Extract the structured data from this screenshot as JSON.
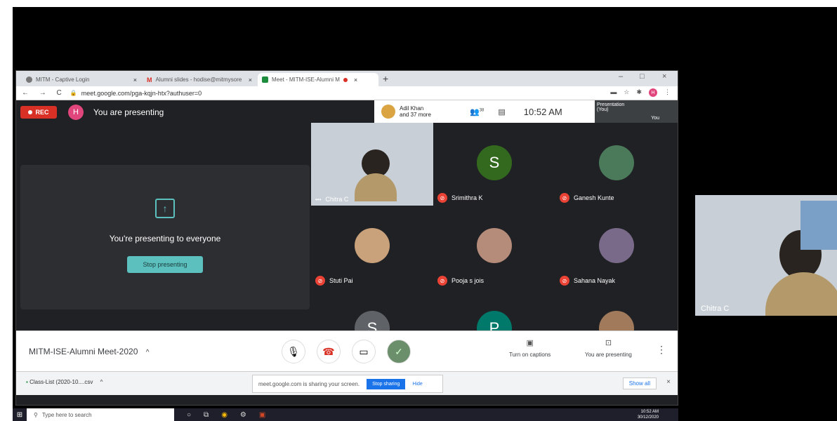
{
  "browser": {
    "tabs": [
      {
        "label": "MITM - Captive Login",
        "close": "×"
      },
      {
        "label": "Alumni slides - hodise@mitmysore",
        "close": "×"
      },
      {
        "label": "Meet - MITM-ISE-Alumni M",
        "close": "×"
      }
    ],
    "new_tab": "+",
    "window_controls": {
      "minimize": "–",
      "maximize": "□",
      "close": "×"
    },
    "nav": "← → C",
    "url": "meet.google.com/pga-kqjn-htx?authuser=0",
    "profile_initial": "H"
  },
  "meet": {
    "rec_label": "REC",
    "presenter_initial": "H",
    "presenting_text": "You are presenting",
    "participants_summary": {
      "name": "Adil Khan",
      "more": "and 37 more"
    },
    "participant_count": "38",
    "clock": "10:52 AM",
    "self_thumb": {
      "line1": "Presentation",
      "line2": "(You)",
      "line3": "You"
    },
    "present_card": {
      "title": "You're presenting to everyone",
      "stop_button": "Stop presenting"
    },
    "tiles": [
      {
        "name": "Chitra C",
        "initial": "",
        "color": "#a8b3bd"
      },
      {
        "name": "Srimithra K",
        "initial": "S",
        "color": "#33691e"
      },
      {
        "name": "Ganesh Kunte",
        "initial": "",
        "color": "#4a7a5a"
      },
      {
        "name": "Stuti Pai",
        "initial": "",
        "color": "#c9a17a"
      },
      {
        "name": "Pooja s jois",
        "initial": "",
        "color": "#b58b7a"
      },
      {
        "name": "Sahana Nayak",
        "initial": "",
        "color": "#7a6a8a"
      },
      {
        "name": "",
        "initial": "S",
        "color": "#5f6368"
      },
      {
        "name": "",
        "initial": "P",
        "color": "#00796b"
      },
      {
        "name": "",
        "initial": "",
        "color": "#a07a5a"
      }
    ],
    "bottom": {
      "meeting_title": "MITM-ISE-Alumni Meet-2020",
      "captions": "Turn on captions",
      "presenting": "You are presenting"
    }
  },
  "download_bar": {
    "file": "Class-List (2020-10....csv",
    "share_notice": "meet.google.com is sharing your screen.",
    "stop_sharing": "Stop sharing",
    "hide": "Hide",
    "show_all": "Show all",
    "close": "×"
  },
  "taskbar": {
    "search": "Type here to search",
    "time": "10:52 AM",
    "date": "30/12/2020"
  },
  "floating_cam": {
    "name": "Chitra C"
  }
}
